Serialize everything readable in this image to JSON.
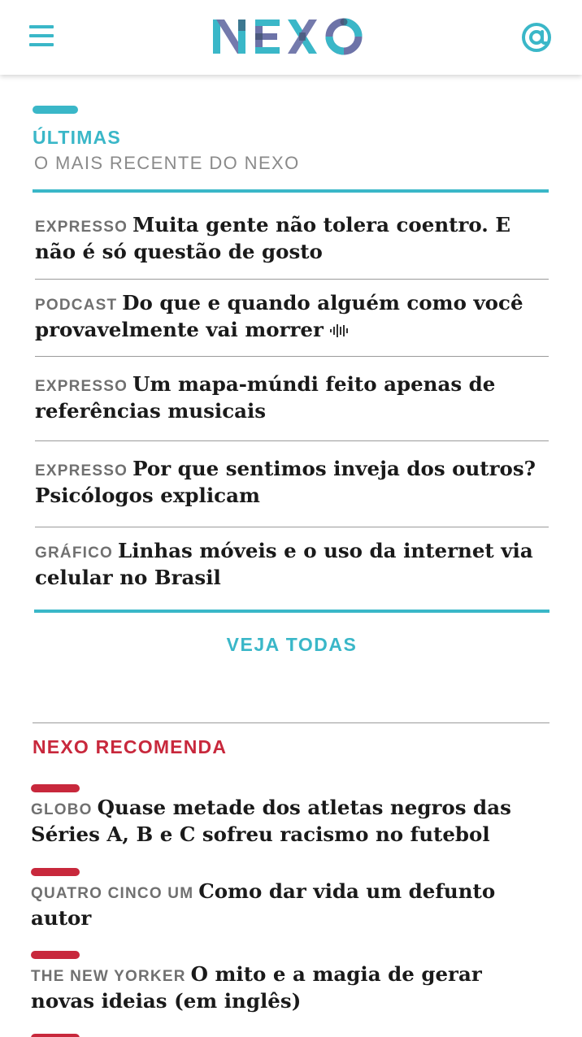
{
  "header": {
    "logo_text": "NEXO",
    "menu_icon": "hamburger-menu-icon",
    "user_icon": "at-sign-icon",
    "accent_color": "#3ab7c8",
    "logo_colors": [
      "#3ab7c8",
      "#6d73a8",
      "#3d4f6b"
    ]
  },
  "ultimas": {
    "title": "ÚLTIMAS",
    "subtitle": "O MAIS RECENTE DO NEXO",
    "items": [
      {
        "kicker": "EXPRESSO",
        "headline": "Muita gente não tolera coentro. E não é só questão de gosto"
      },
      {
        "kicker": "PODCAST",
        "headline": "Do que e quando alguém como você provavelmente vai morrer",
        "icon": "audio-waveform-icon"
      },
      {
        "kicker": "EXPRESSO",
        "headline": "Um mapa-múndi feito apenas de referências musicais"
      },
      {
        "kicker": "EXPRESSO",
        "headline": "Por que sentimos inveja dos outros? Psicólogos explicam"
      },
      {
        "kicker": "GRÁFICO",
        "headline": "Linhas móveis e o uso da internet via celular no Brasil"
      }
    ],
    "see_all_label": "VEJA TODAS"
  },
  "recomenda": {
    "title": "NEXO RECOMENDA",
    "accent_color": "#c8283c",
    "items": [
      {
        "source": "GLOBO",
        "headline": "Quase metade dos atletas negros das Séries A, B e C sofreu racismo no futebol"
      },
      {
        "source": "QUATRO CINCO UM",
        "headline": "Como dar vida um defunto autor"
      },
      {
        "source": "THE NEW YORKER",
        "headline": "O mito e a magia de gerar novas ideias (em inglês)"
      }
    ]
  }
}
